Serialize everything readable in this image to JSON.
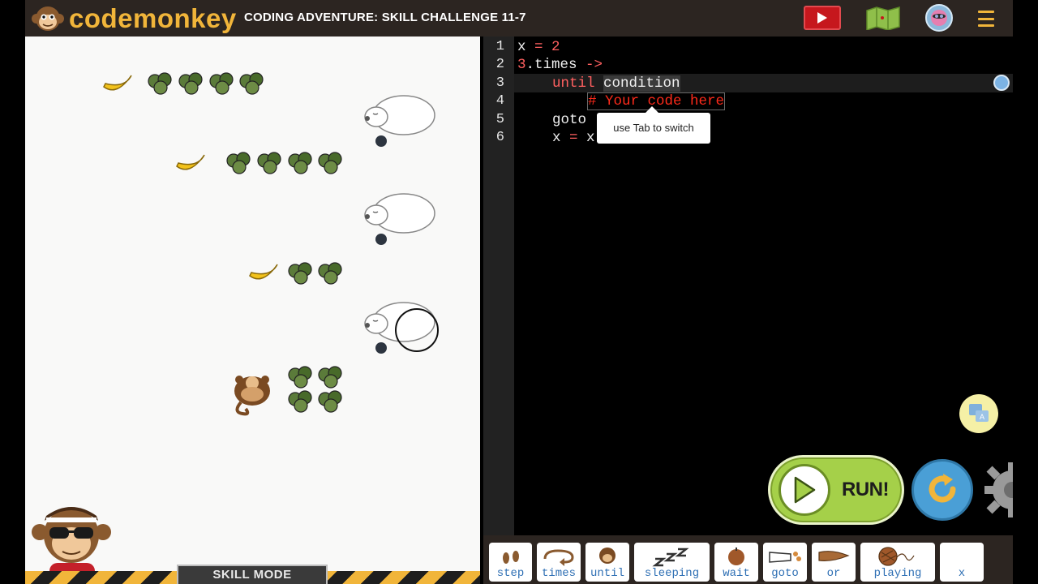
{
  "header": {
    "logo_text": "codemonkey",
    "level_title": "CODING ADVENTURE: SKILL CHALLENGE 11-7",
    "buttons": [
      "video-icon",
      "map-icon",
      "avatar-icon",
      "menu-icon"
    ]
  },
  "game": {
    "skill_mode_label": "SKILL MODE",
    "rows": [
      {
        "banana": true,
        "bushes": 4
      },
      {
        "banana": true,
        "bushes": 4
      },
      {
        "banana": true,
        "bushes": 2
      },
      {
        "banana": false,
        "bushes": 4
      }
    ]
  },
  "editor": {
    "line_numbers": [
      "1",
      "2",
      "3",
      "4",
      "5",
      "6"
    ],
    "lines": {
      "l1_a": "x",
      "l1_b": " = ",
      "l1_c": "2",
      "l2_a": "3",
      "l2_b": ".times ",
      "l2_c": "->",
      "l3_a": "until",
      "l3_b": "condition",
      "l4_comment": "# Your code here",
      "l5": "goto",
      "l6_a": "x",
      "l6_b": " = ",
      "l6_c": "x"
    },
    "tooltip": "use Tab to switch"
  },
  "controls": {
    "run_label": "RUN!"
  },
  "palette": {
    "commands": [
      "step",
      "times",
      "until",
      "sleeping",
      "wait",
      "goto",
      "or",
      "playing",
      "x"
    ]
  },
  "colors": {
    "topbar": "#2c2521",
    "brand_yellow": "#f1b53a",
    "run_green": "#a5d049",
    "keyword_red": "#ff6060",
    "command_blue": "#2e6fb4"
  }
}
